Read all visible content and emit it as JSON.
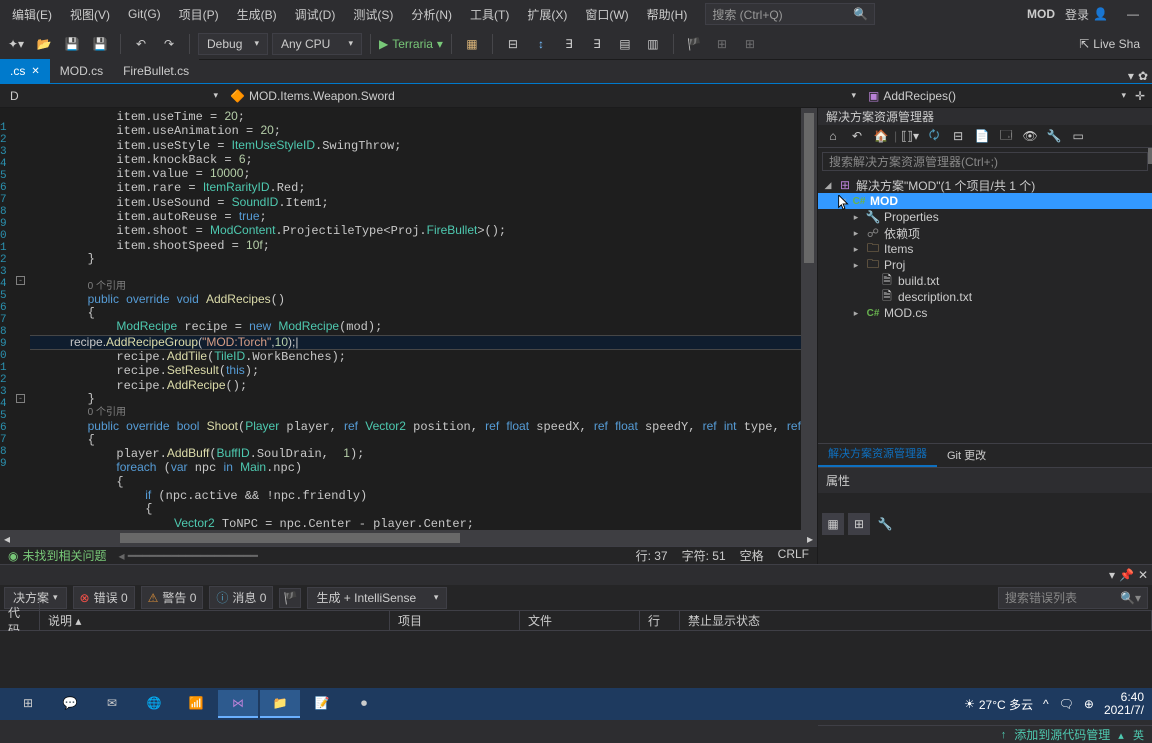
{
  "menu": {
    "items": [
      "编辑(E)",
      "视图(V)",
      "Git(G)",
      "项目(P)",
      "生成(B)",
      "调试(D)",
      "测试(S)",
      "分析(N)",
      "工具(T)",
      "扩展(X)",
      "窗口(W)",
      "帮助(H)"
    ],
    "search_placeholder": "搜索 (Ctrl+Q)",
    "app_title": "MOD",
    "login": "登录",
    "minimize": "—"
  },
  "toolbar": {
    "config": "Debug",
    "platform": "Any CPU",
    "run_target": "Terraria",
    "liveshare": "Live Sha"
  },
  "tabs": {
    "items": [
      {
        "label": ".cs",
        "active": true
      },
      {
        "label": "MOD.cs",
        "active": false
      },
      {
        "label": "FireBullet.cs",
        "active": false
      }
    ]
  },
  "nav": {
    "left": "D",
    "mid": "MOD.Items.Weapon.Sword",
    "right": "AddRecipes()"
  },
  "status": {
    "ok_text": "未找到相关问题",
    "line": "行: 37",
    "col": "字符: 51",
    "spaces": "空格",
    "eol": "CRLF"
  },
  "solution": {
    "panel_title": "解决方案资源管理器",
    "search_placeholder": "搜索解决方案资源管理器(Ctrl+;)",
    "root": "解决方案\"MOD\"(1 个项目/共 1 个)",
    "project": "MOD",
    "nodes": {
      "properties": "Properties",
      "deps": "依赖项",
      "items": "Items",
      "proj": "Proj",
      "build": "build.txt",
      "desc": "description.txt",
      "modcs": "MOD.cs"
    },
    "tabs": {
      "explorer": "解决方案资源管理器",
      "git": "Git 更改"
    },
    "properties_title": "属性",
    "bottom_text": "添加到源代码管理"
  },
  "errorlist": {
    "scope": "决方案",
    "errors": "错误 0",
    "warnings": "警告 0",
    "messages": "消息 0",
    "build_filter": "生成 + IntelliSense",
    "search_placeholder": "搜索错误列表",
    "cols": {
      "code": "代码",
      "desc": "说明",
      "proj": "项目",
      "file": "文件",
      "line": "行",
      "suppress": "禁止显示状态"
    }
  },
  "references": "0 个引用",
  "taskbar": {
    "weather": "27°C 多云",
    "time": "6:40",
    "date": "2021/7/"
  }
}
